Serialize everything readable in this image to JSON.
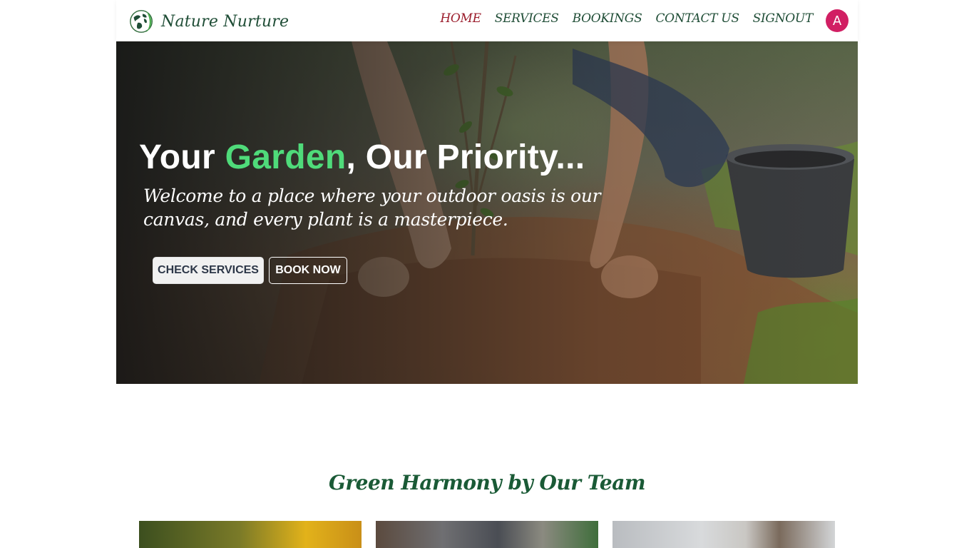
{
  "brand": {
    "name": "Nature Nurture"
  },
  "nav": {
    "items": [
      {
        "label": "HOME",
        "active": true
      },
      {
        "label": "SERVICES",
        "active": false
      },
      {
        "label": "BOOKINGS",
        "active": false
      },
      {
        "label": "CONTACT US",
        "active": false
      },
      {
        "label": "SIGNOUT",
        "active": false
      }
    ],
    "avatar_letter": "A"
  },
  "hero": {
    "title_part1": "Your ",
    "title_accent": "Garden",
    "title_part2": ", Our Priority...",
    "subtitle": "Welcome to a place where your outdoor oasis is our canvas, and every plant is a masterpiece.",
    "primary_button": "CHECK SERVICES",
    "secondary_button": "BOOK NOW"
  },
  "team": {
    "title": "Green Harmony by Our Team"
  },
  "colors": {
    "brand_green": "#1f4d36",
    "active_nav": "#9b1d2c",
    "accent_green": "#4fdb7a",
    "avatar_bg": "#d11f63",
    "section_title": "#1a5a36"
  }
}
